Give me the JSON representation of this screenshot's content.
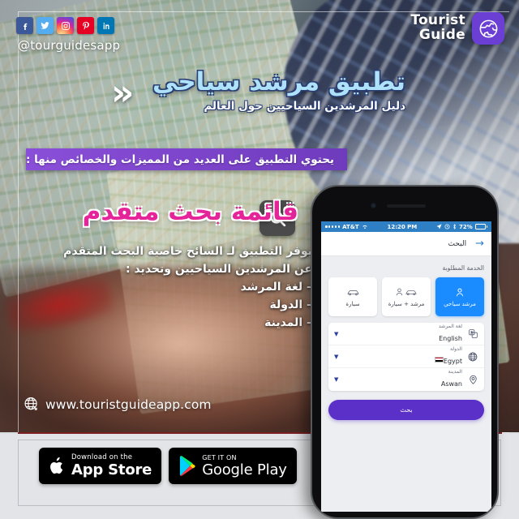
{
  "social": {
    "handle": "@tourguidesapp",
    "icons": [
      {
        "name": "facebook-icon",
        "label": "f",
        "color": "#3b5998"
      },
      {
        "name": "twitter-icon",
        "label": "t",
        "color": "#55acee"
      },
      {
        "name": "instagram-icon",
        "label": "ig",
        "color": "#d6249f"
      },
      {
        "name": "pinterest-icon",
        "label": "P",
        "color": "#e60023"
      },
      {
        "name": "linkedin-icon",
        "label": "in",
        "color": "#0077b5"
      }
    ]
  },
  "brand": {
    "line1": "Tourist",
    "line2": "Guide",
    "icon": "globe-app-icon",
    "icon_color": "#6b3fd4"
  },
  "hero": {
    "chevron": "»",
    "title": "تطبيق مرشد سياحي",
    "subtitle": "دليل المرشدين السياحيين حول العالم",
    "title_color": "#aee2fb"
  },
  "banner": {
    "text": "يحتوي التطبيق على العديد من المميزات والخصائص منها :",
    "color": "#7a43c8"
  },
  "feature": {
    "icon": "search-icon",
    "heading": "قائمة بحث متقدم",
    "heading_color": "#e5249a",
    "description_line1": "يوفر التطبيق لـ السائح خاصية البحث المتقدم",
    "description_line2": "عن المرشدين السياحيين وتحديد :",
    "bullets": [
      "– لغة المرشد",
      "– الدولة",
      "– المدينة"
    ]
  },
  "website": {
    "icon": "globe-icon",
    "url": "www.touristguideapp.com"
  },
  "store_badges": [
    {
      "name": "app-store-badge",
      "small": "Download on the",
      "big": "App Store",
      "icon": "apple-icon"
    },
    {
      "name": "google-play-badge",
      "small": "GET IT ON",
      "big": "Google Play",
      "icon": "google-play-icon"
    }
  ],
  "phone": {
    "statusbar": {
      "carrier": "AT&T",
      "time": "12:20 PM",
      "battery": "72%",
      "wifi_icon": "wifi-icon",
      "location_icon": "location-arrow-icon",
      "alarm_icon": "alarm-icon",
      "bluetooth_icon": "bluetooth-icon"
    },
    "navbar": {
      "title": "البحث",
      "arrow_icon": "arrow-right-icon"
    },
    "section_label": "الخدمة المطلوبة",
    "services": [
      {
        "label": "سيارة",
        "icon": "car-icon",
        "selected": false
      },
      {
        "label": "مرشد + سيارة",
        "icon": "car-guide-icon",
        "selected": false
      },
      {
        "label": "مرشد سياحي",
        "icon": "guide-icon",
        "selected": true
      }
    ],
    "selected_service_color": "#1a8cff",
    "form_rows": [
      {
        "label": "لغة المرشد",
        "value": "English",
        "icon": "translate-icon",
        "flag": false
      },
      {
        "label": "الدولة",
        "value": "Egypt",
        "icon": "globe-icon",
        "flag": true
      },
      {
        "label": "المدينة",
        "value": "Aswan",
        "icon": "map-pin-icon",
        "flag": false
      }
    ],
    "search_button": {
      "label": "بحث",
      "color": "#5a30c8"
    }
  }
}
